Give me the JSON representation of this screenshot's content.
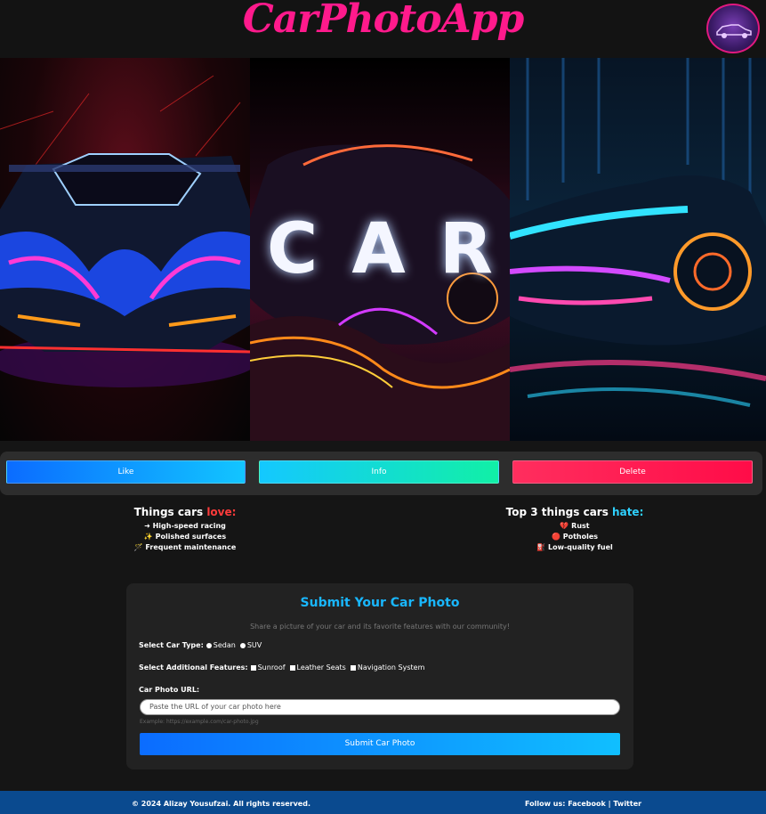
{
  "header": {
    "title": "CarPhotoApp",
    "avatar_icon": "car-avatar-icon"
  },
  "hero": {
    "letters": [
      "C",
      "A",
      "R"
    ]
  },
  "actions": {
    "like": "Like",
    "info": "Info",
    "delete": "Delete"
  },
  "love": {
    "title_prefix": "Things cars ",
    "title_highlight": "love:",
    "items": [
      "➜ High-speed racing",
      "✨ Polished surfaces",
      "🪄 Frequent maintenance"
    ]
  },
  "hate": {
    "title_prefix": "Top 3 things cars ",
    "title_highlight": "hate:",
    "items": [
      "💔 Rust",
      "🔴 Potholes",
      "⛽ Low-quality fuel"
    ]
  },
  "form": {
    "title": "Submit Your Car Photo",
    "subtitle": "Share a picture of your car and its favorite features with our community!",
    "car_type_label": "Select Car Type:",
    "car_types": [
      "Sedan",
      "SUV"
    ],
    "features_label": "Select Additional Features:",
    "features": [
      "Sunroof",
      "Leather Seats",
      "Navigation System"
    ],
    "url_label": "Car Photo URL:",
    "url_placeholder": "Paste the URL of your car photo here",
    "example": "Example: https://example.com/car-photo.jpg",
    "submit_label": "Submit Car Photo"
  },
  "footer": {
    "copyright": "© 2024 Alizay Yousufzai. All rights reserved.",
    "follow_prefix": "Follow us: ",
    "facebook": "Facebook",
    "separator": " | ",
    "twitter": "Twitter"
  },
  "colors": {
    "brand": "#ff1a8c",
    "love": "#ff3b3b",
    "hate": "#2fd1ff",
    "form_title": "#19b7ff",
    "footer": "#0a4a8f"
  }
}
